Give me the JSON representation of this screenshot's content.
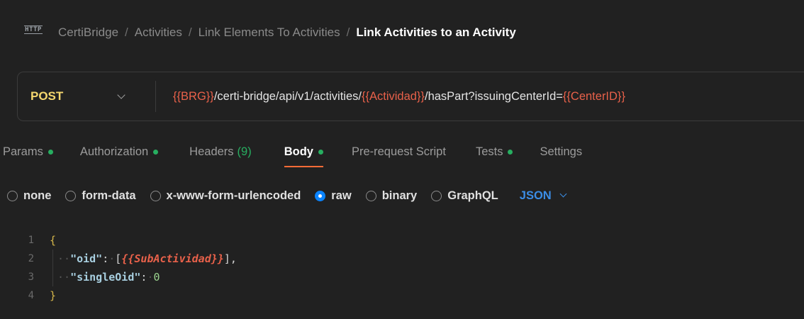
{
  "breadcrumb": {
    "icon": "http-icon",
    "icon_text": "HTTP",
    "separator": "/",
    "items": [
      "CertiBridge",
      "Activities",
      "Link Elements To Activities"
    ],
    "current": "Link Activities to an Activity"
  },
  "request": {
    "method": "POST",
    "url_parts": [
      {
        "text": "{{BRG}}",
        "var": true
      },
      {
        "text": "/certi-bridge/api/v1/activities/",
        "var": false
      },
      {
        "text": "{{Actividad}}",
        "var": true
      },
      {
        "text": "/hasPart?issuingCenterId=",
        "var": false
      },
      {
        "text": "{{CenterID}}",
        "var": true
      }
    ]
  },
  "tabs": [
    {
      "label": "Params",
      "dot": true,
      "active": false
    },
    {
      "label": "Authorization",
      "dot": true,
      "active": false
    },
    {
      "label": "Headers",
      "count": "(9)",
      "active": false
    },
    {
      "label": "Body",
      "dot": true,
      "active": true
    },
    {
      "label": "Pre-request Script",
      "active": false
    },
    {
      "label": "Tests",
      "dot": true,
      "active": false
    },
    {
      "label": "Settings",
      "active": false
    }
  ],
  "body_types": [
    {
      "label": "none",
      "selected": false
    },
    {
      "label": "form-data",
      "selected": false
    },
    {
      "label": "x-www-form-urlencoded",
      "selected": false
    },
    {
      "label": "raw",
      "selected": true
    },
    {
      "label": "binary",
      "selected": false
    },
    {
      "label": "GraphQL",
      "selected": false
    }
  ],
  "body_format": "JSON",
  "editor": {
    "line_numbers": [
      "1",
      "2",
      "3",
      "4"
    ],
    "open_brace": "{",
    "close_brace": "}",
    "indent": "··",
    "oid_key": "\"oid\"",
    "oid_colon": ":",
    "oid_open": "[",
    "oid_var": "{{SubActividad}}",
    "oid_close": "],",
    "single_key": "\"singleOid\"",
    "single_colon": ":",
    "single_value": "0"
  },
  "colors": {
    "accent": "#ff6c37",
    "method": "#f5d76e",
    "variable": "#e8614a",
    "status_dot": "#27ae60",
    "selected_radio": "#0a84ff",
    "format": "#3b8de6"
  }
}
